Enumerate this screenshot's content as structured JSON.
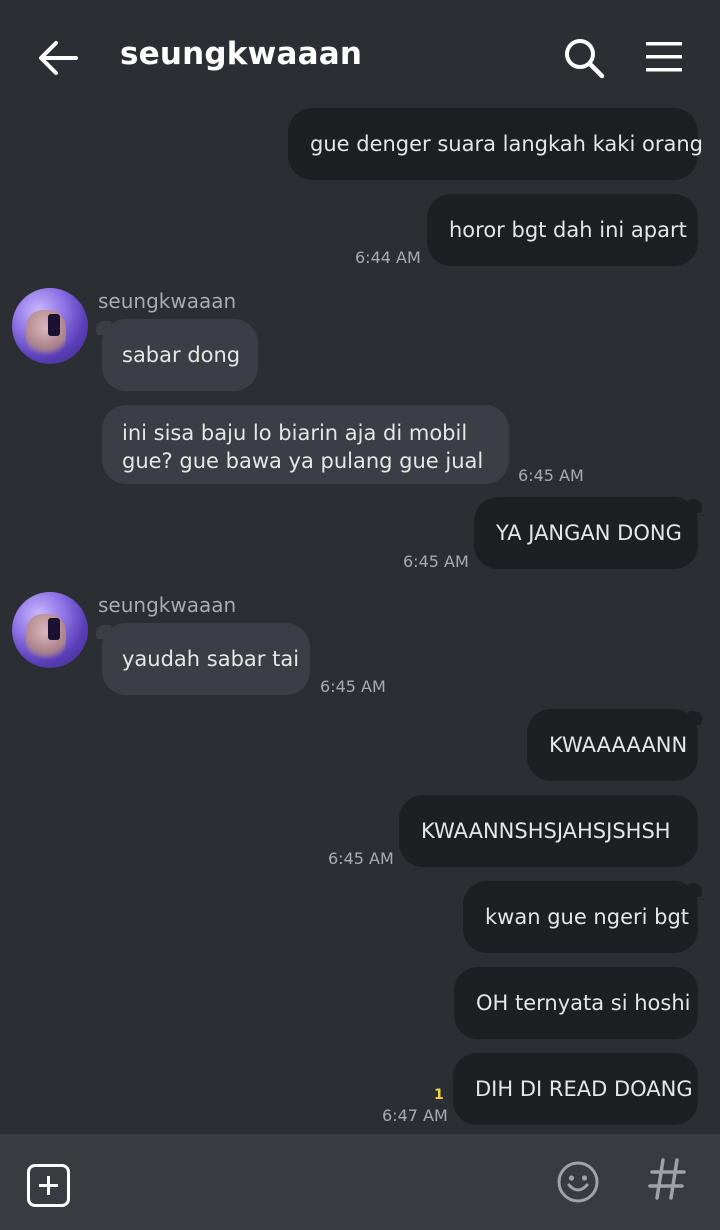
{
  "header": {
    "back_icon": "arrow-left-icon",
    "title": "seungkwaaan",
    "search_icon": "search-icon",
    "menu_icon": "hamburger-menu-icon"
  },
  "messages": [
    {
      "dir": "out",
      "text": "gue denger suara langkah kaki orang"
    },
    {
      "dir": "out",
      "text": "horor bgt dah ini apart",
      "time": "6:44 AM"
    },
    {
      "dir": "in",
      "sender": "seungkwaaan",
      "text": "sabar dong"
    },
    {
      "dir": "in",
      "text_line1": "ini sisa baju lo biarin aja di mobil",
      "text_line2": "gue? gue bawa ya pulang gue jual",
      "time": "6:45 AM"
    },
    {
      "dir": "out",
      "text": "YA JANGAN DONG",
      "time": "6:45 AM"
    },
    {
      "dir": "in",
      "sender": "seungkwaaan",
      "text": "yaudah sabar tai",
      "time": "6:45 AM"
    },
    {
      "dir": "out",
      "text": "KWAAAAANN"
    },
    {
      "dir": "out",
      "text": "KWAANNSHSJAHSJSHSH",
      "time": "6:45 AM"
    },
    {
      "dir": "out",
      "text": "kwan gue ngeri bgt"
    },
    {
      "dir": "out",
      "text": "OH ternyata si hoshi"
    },
    {
      "dir": "out",
      "text": "DIH DI READ DOANG",
      "time": "6:47 AM",
      "unread_count": "1"
    }
  ],
  "bottom_bar": {
    "add_icon": "plus-square-icon",
    "emoji_icon": "smiley-icon",
    "hashtag_icon": "hashtag-icon"
  },
  "colors": {
    "background": "#2b2e33",
    "outgoing_bubble": "#1e1f23",
    "incoming_bubble": "#3b3e45",
    "unread_indicator": "#f0d24a"
  }
}
